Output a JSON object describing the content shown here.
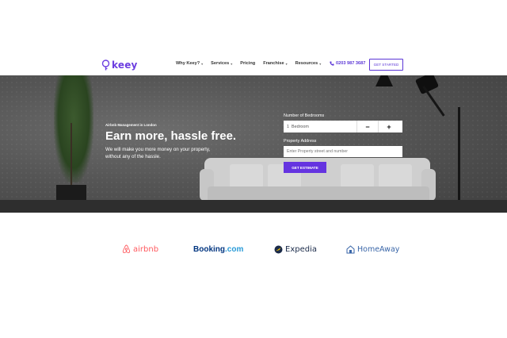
{
  "header": {
    "logo_text": "keey",
    "nav": [
      {
        "label": "Why Keey?",
        "has_dropdown": true
      },
      {
        "label": "Services",
        "has_dropdown": true
      },
      {
        "label": "Pricing",
        "has_dropdown": false
      },
      {
        "label": "Franchise",
        "has_dropdown": true
      },
      {
        "label": "Resources",
        "has_dropdown": true
      }
    ],
    "phone": "0203 987 3687",
    "cta_label": "GET STARTED"
  },
  "hero": {
    "eyebrow": "Airbnb Management in London",
    "headline": "Earn more, hassle free.",
    "subline": "We will make you more money on your property, without any of the hassle."
  },
  "form": {
    "bedrooms_label": "Number of Bedrooms",
    "bedrooms_value": "1",
    "bedrooms_unit": "Bedroom",
    "minus_label": "−",
    "plus_label": "+",
    "address_label": "Property Address",
    "address_placeholder": "Enter Property street and number",
    "submit_label": "GET ESTIMATE"
  },
  "partners": {
    "airbnb": "airbnb",
    "booking": "Booking",
    "booking_tld": ".com",
    "expedia": "Expedia",
    "homeaway": "HomeAway"
  },
  "colors": {
    "brand": "#6c3ee0",
    "airbnb": "#ff5a5f",
    "booking": "#003580",
    "homeaway": "#3a66a8"
  },
  "icons": {
    "logo": "key-bulb-icon",
    "phone": "phone-icon",
    "dropdown": "chevron-down-icon"
  }
}
